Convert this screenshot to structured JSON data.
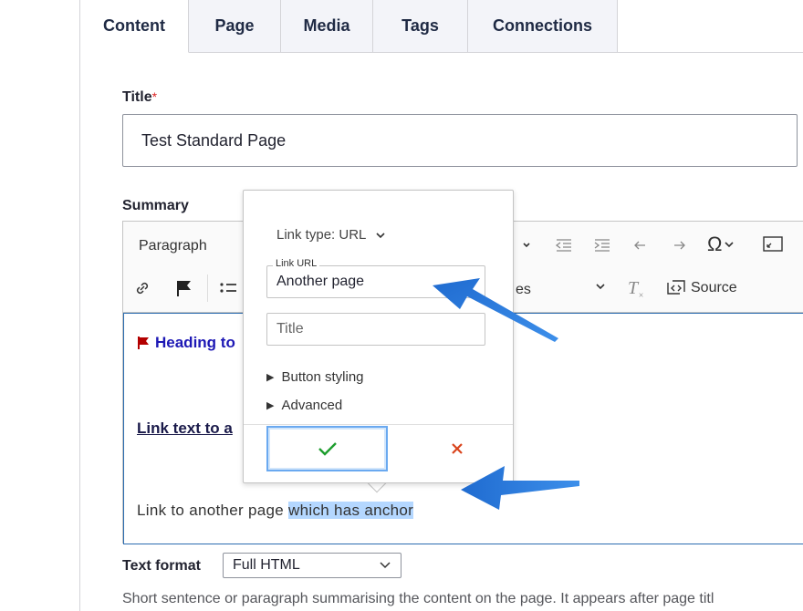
{
  "tabs": [
    {
      "label": "Content",
      "active": true
    },
    {
      "label": "Page",
      "active": false
    },
    {
      "label": "Media",
      "active": false
    },
    {
      "label": "Tags",
      "active": false
    },
    {
      "label": "Connections",
      "active": false
    }
  ],
  "title_field": {
    "label": "Title",
    "required_mark": "*",
    "value": "Test Standard Page"
  },
  "summary": {
    "label": "Summary",
    "toolbar": {
      "paragraph_label": "Paragraph",
      "source_label": "Source",
      "styles_partial": "es"
    },
    "content": {
      "heading_partial": "Heading to",
      "link_text_partial": "Link text to a",
      "paragraph_text": "Link to another page ",
      "highlighted_text": "which has anchor"
    }
  },
  "link_popup": {
    "link_type": "Link type: URL",
    "link_url_label": "Link URL",
    "link_url_value": "Another page",
    "title_placeholder": "Title",
    "button_styling_label": "Button styling",
    "advanced_label": "Advanced"
  },
  "text_format": {
    "label": "Text format",
    "value": "Full HTML"
  },
  "description": "Short sentence or paragraph summarising the content on the page. It appears after page titl",
  "colors": {
    "accent_blue": "#1f6bd0",
    "save_green": "#1e9e2e",
    "cancel_red": "#d9441c"
  }
}
